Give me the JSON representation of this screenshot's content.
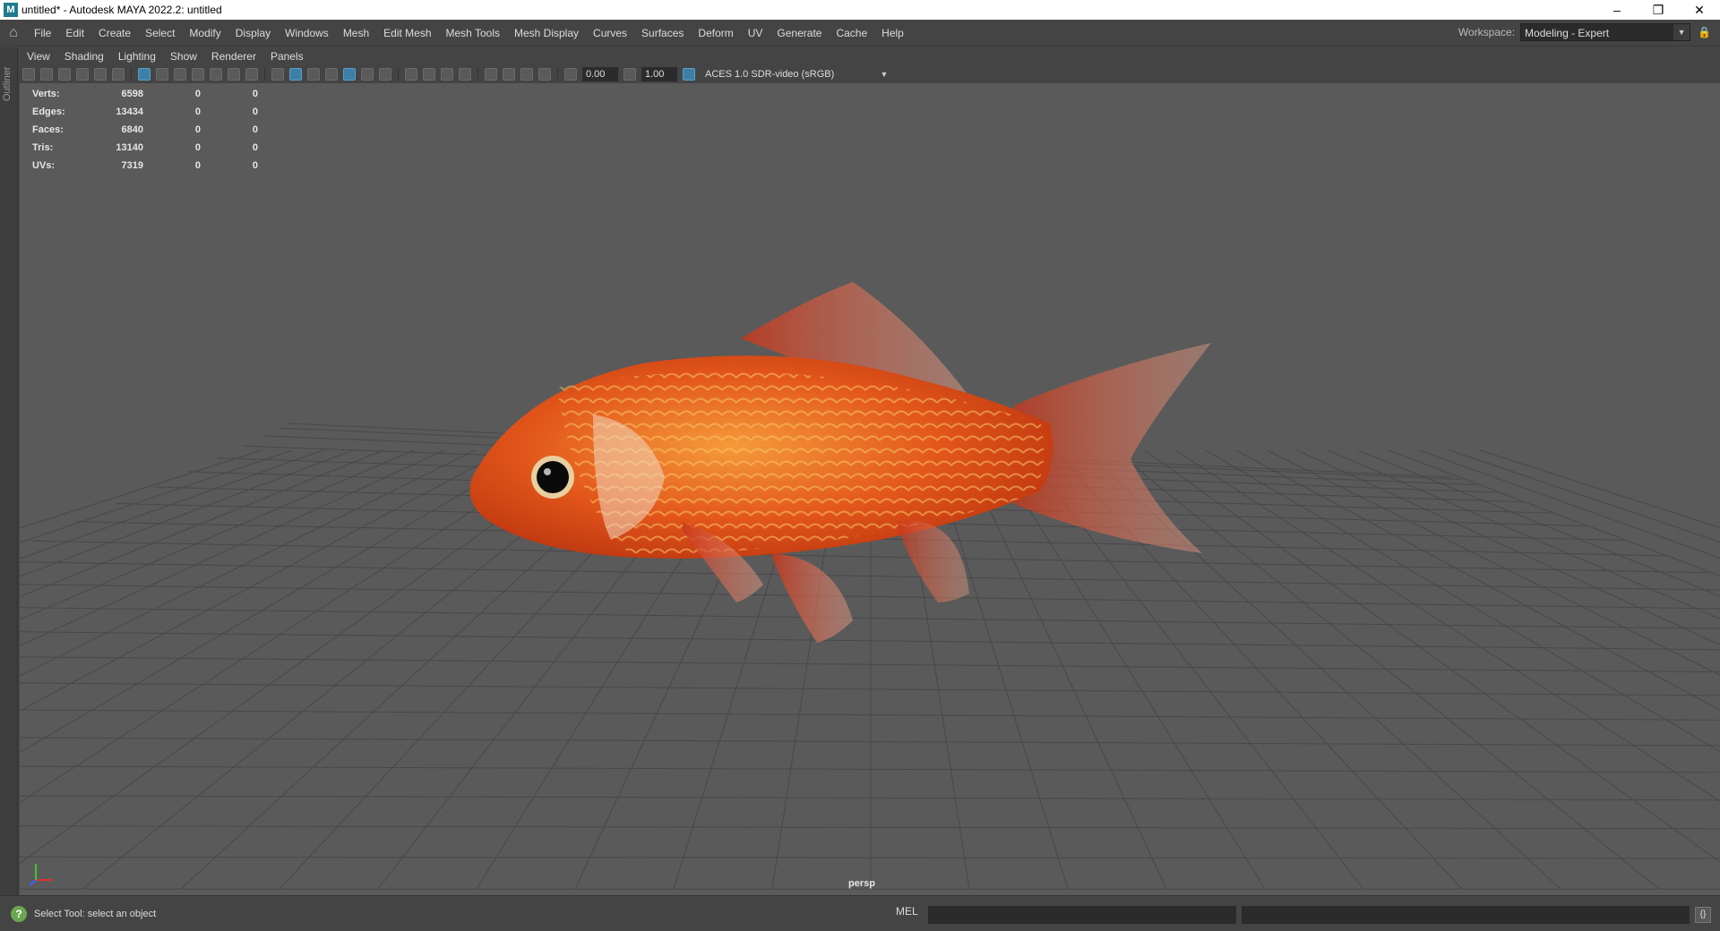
{
  "window": {
    "title": "untitled* - Autodesk MAYA 2022.2: untitled",
    "app_icon": "M"
  },
  "main_menu": [
    "File",
    "Edit",
    "Create",
    "Select",
    "Modify",
    "Display",
    "Windows",
    "Mesh",
    "Edit Mesh",
    "Mesh Tools",
    "Mesh Display",
    "Curves",
    "Surfaces",
    "Deform",
    "UV",
    "Generate",
    "Cache",
    "Help"
  ],
  "workspace": {
    "label": "Workspace:",
    "value": "Modeling - Expert"
  },
  "outliner_label": "Outliner",
  "panel_menu": [
    "View",
    "Shading",
    "Lighting",
    "Show",
    "Renderer",
    "Panels"
  ],
  "toolbar": {
    "exposure": "0.00",
    "gamma": "1.00",
    "colorspace": "ACES 1.0 SDR-video (sRGB)"
  },
  "hud": [
    {
      "label": "Verts:",
      "value": "6598",
      "a": "0",
      "b": "0"
    },
    {
      "label": "Edges:",
      "value": "13434",
      "a": "0",
      "b": "0"
    },
    {
      "label": "Faces:",
      "value": "6840",
      "a": "0",
      "b": "0"
    },
    {
      "label": "Tris:",
      "value": "13140",
      "a": "0",
      "b": "0"
    },
    {
      "label": "UVs:",
      "value": "7319",
      "a": "0",
      "b": "0"
    }
  ],
  "camera_label": "persp",
  "status": {
    "help_line": "Select Tool: select an object",
    "mel_label": "MEL"
  },
  "colors": {
    "viewport_bg": "#5a5a5a",
    "fish_body": "#e2561a",
    "accent": "#3d7fa6"
  }
}
